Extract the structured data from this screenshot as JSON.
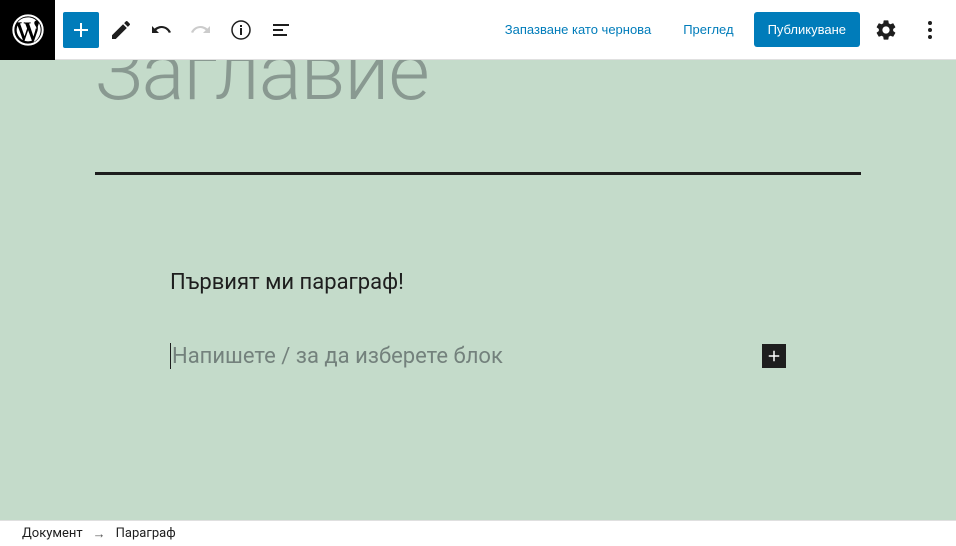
{
  "toolbar": {
    "save_draft": "Запазване като чернова",
    "preview": "Преглед",
    "publish": "Публикуване"
  },
  "editor": {
    "title_placeholder": "Заглавие",
    "paragraph_1": "Първият ми параграф!",
    "block_prompt": "Напишете / за да изберете блок"
  },
  "breadcrumb": {
    "root": "Документ",
    "current": "Параграф"
  }
}
